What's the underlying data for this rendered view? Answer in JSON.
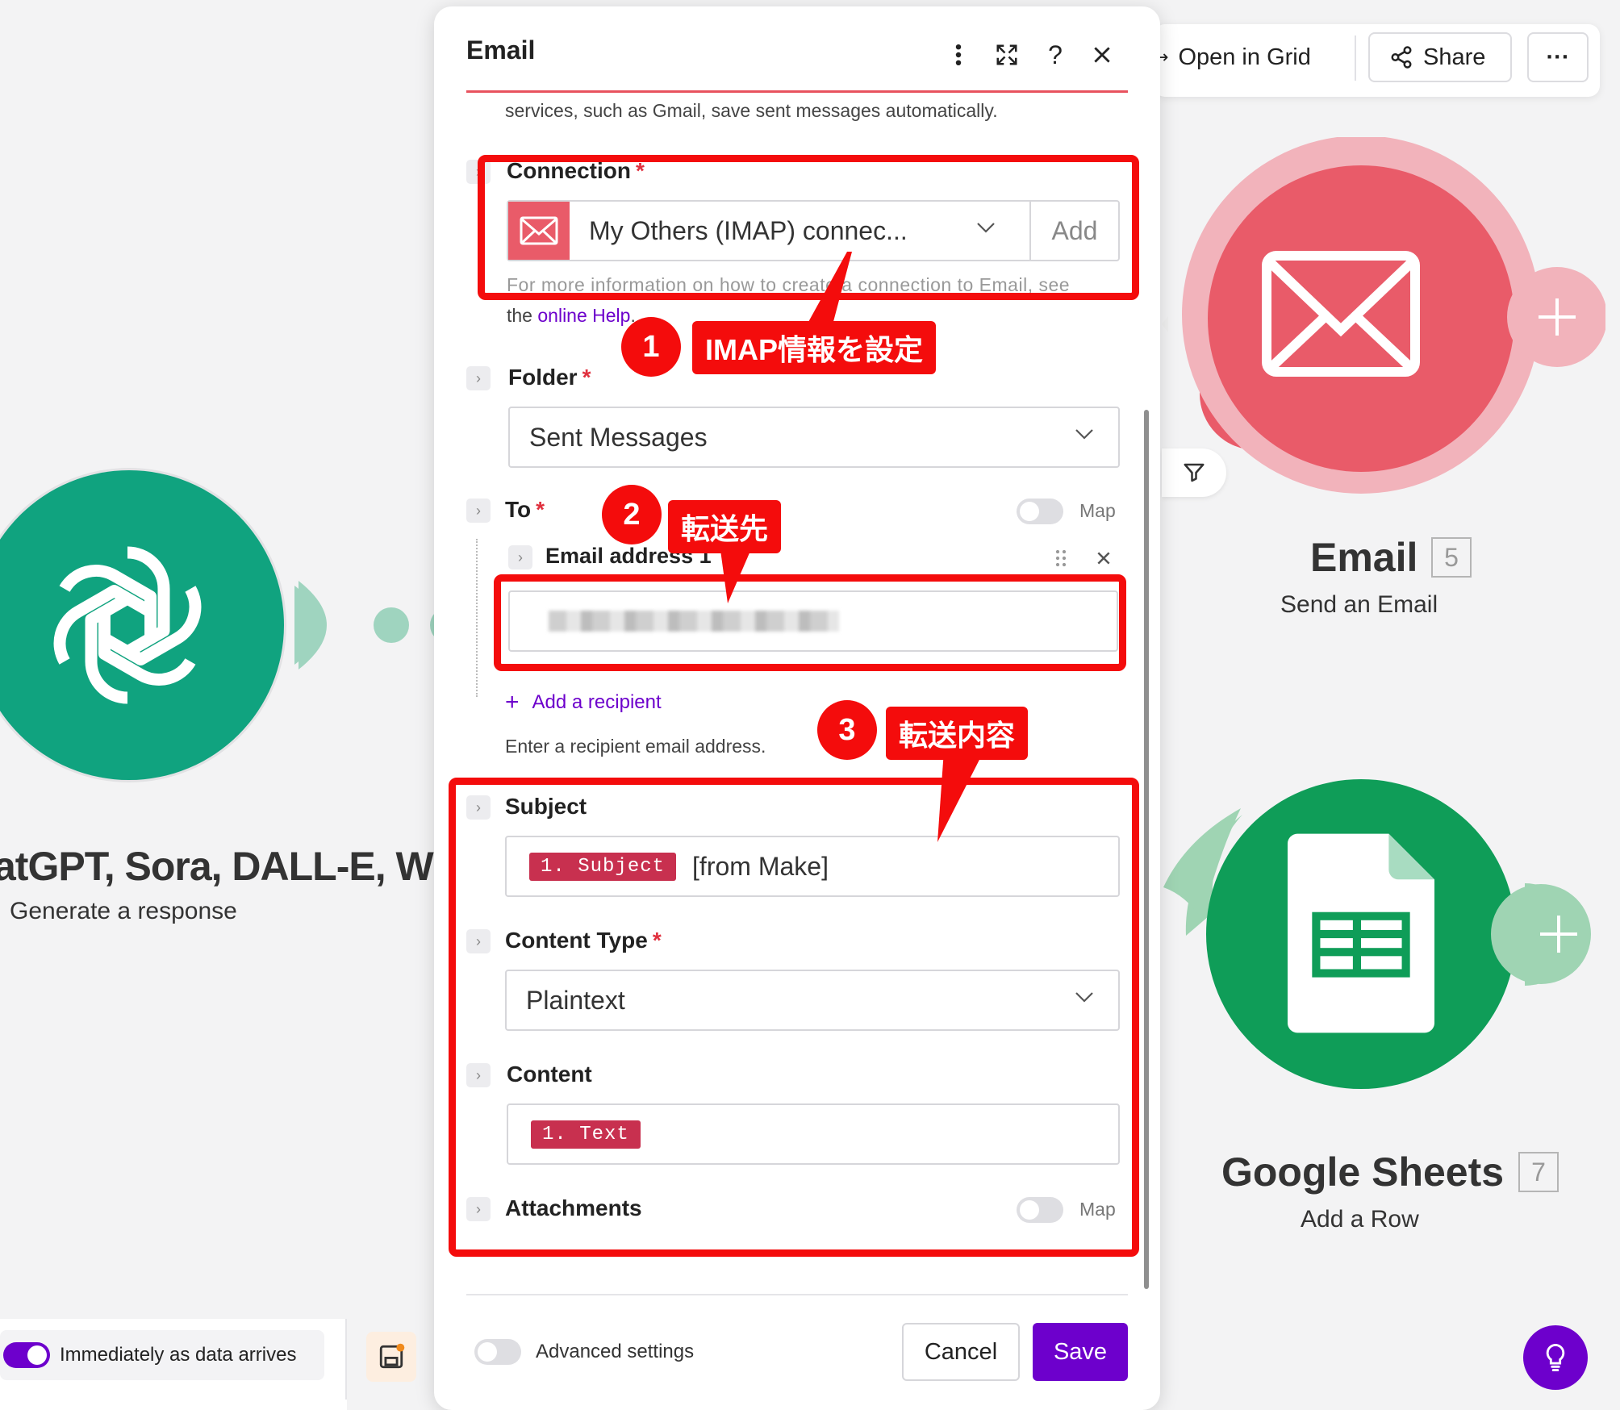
{
  "toolbar": {
    "open_in_grid": "Open in Grid",
    "share": "Share",
    "more": "···"
  },
  "modules": {
    "openai": {
      "title": "atGPT, Sora, DALL-E, Whisper)",
      "subtitle": "Generate a response",
      "color": "#10a37f"
    },
    "email": {
      "title": "Email",
      "badge": "5",
      "subtitle": "Send an Email",
      "color": "#e95b69"
    },
    "sheets": {
      "title": "Google Sheets",
      "badge": "7",
      "subtitle": "Add a Row",
      "color": "#0f9d58"
    }
  },
  "schedule": {
    "label": "Immediately as data arrives",
    "enabled": true
  },
  "dialog": {
    "title": "Email",
    "intro_text": "services, such as Gmail, save sent messages automatically.",
    "connection": {
      "label": "Connection",
      "value": "My Others (IMAP) connec...",
      "add_label": "Add",
      "help_prefix": "the",
      "help_link": "online Help",
      "help_suffix": "."
    },
    "folder": {
      "label": "Folder",
      "value": "Sent Messages"
    },
    "to": {
      "label": "To",
      "map_label": "Map",
      "item_label": "Email address 1",
      "item_value": "",
      "add_recipient": "Add a recipient",
      "help": "Enter a recipient email address."
    },
    "subject": {
      "label": "Subject",
      "pill": "1. Subject",
      "suffix": "[from Make]"
    },
    "content_type": {
      "label": "Content Type",
      "value": "Plaintext"
    },
    "content": {
      "label": "Content",
      "pill": "1. Text"
    },
    "attachments": {
      "label": "Attachments",
      "map_label": "Map"
    },
    "advanced_settings": "Advanced settings",
    "cancel": "Cancel",
    "save": "Save"
  },
  "annotations": {
    "one": {
      "number": "1",
      "text": "IMAP情報を設定"
    },
    "two": {
      "number": "2",
      "text": "転送先"
    },
    "three": {
      "number": "3",
      "text": "転送内容"
    }
  },
  "colors": {
    "accent": "#6d00cc",
    "annotation_red": "#f40c0c",
    "pill": "#c8304f"
  }
}
